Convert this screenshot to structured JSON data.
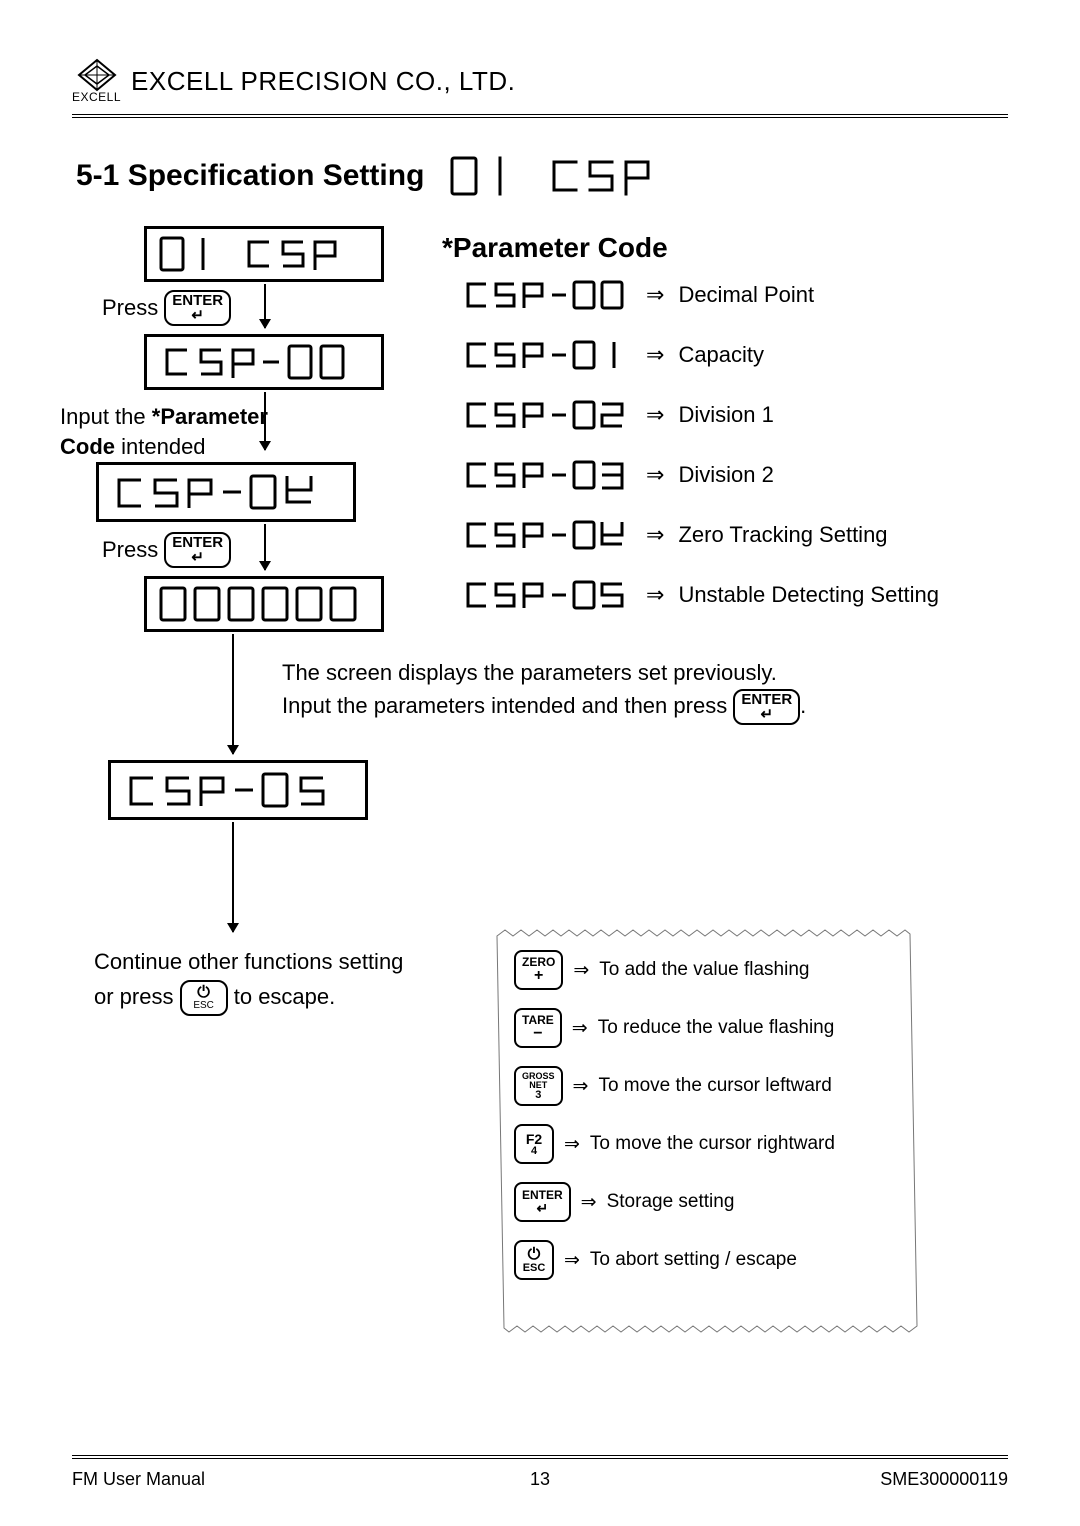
{
  "header": {
    "logo_text": "EXCELL",
    "company": "EXCELL PRECISION CO., LTD."
  },
  "section": {
    "number_and_title": "5-1 Specification Setting",
    "title_segment": "01  CSP"
  },
  "flow": {
    "lcd1": "01  CSP",
    "press1": "Press",
    "key_enter": "ENTER",
    "lcd2": "CSP-00",
    "input_label_line1": "Input the",
    "input_label_bold": "*Parameter",
    "input_label_line2": "Code",
    "input_label_rest": "intended",
    "lcd3": "CSP-04",
    "press2": "Press",
    "lcd4": "000000",
    "paragraph_line1": "The screen displays the parameters set previously.",
    "paragraph_line2_a": "Input the parameters intended and then press",
    "paragraph_line2_b": ".",
    "lcd5": "CSP-05",
    "continue_line1": "Continue other functions setting",
    "continue_line2a": "or press",
    "continue_line2b": "to escape.",
    "key_esc_top": "⏻",
    "key_esc_sub": "ESC"
  },
  "pcode": {
    "title": "*Parameter Code",
    "rows": [
      {
        "seg": "CSP-00",
        "desc": "Decimal Point"
      },
      {
        "seg": "CSP-01",
        "desc": "Capacity"
      },
      {
        "seg": "CSP-02",
        "desc": "Division 1"
      },
      {
        "seg": "CSP-03",
        "desc": "Division 2"
      },
      {
        "seg": "CSP-04",
        "desc": "Zero Tracking Setting"
      },
      {
        "seg": "CSP-05",
        "desc": "Unstable Detecting Setting"
      }
    ]
  },
  "legend": {
    "rows": [
      {
        "key_top": "ZERO",
        "key_sub": "+",
        "desc": "To add the value flashing"
      },
      {
        "key_top": "TARE",
        "key_sub": "−",
        "desc": "To reduce the value flashing"
      },
      {
        "key_top": "GROSS\nNET",
        "key_sub": "3",
        "desc": "To move the cursor leftward"
      },
      {
        "key_top": "F2",
        "key_sub": "4",
        "desc": "To move the cursor rightward"
      },
      {
        "key_top": "ENTER",
        "key_sub": "↵",
        "desc": "Storage setting"
      },
      {
        "key_top": "⏻",
        "key_sub": "ESC",
        "desc": "To abort setting / escape"
      }
    ]
  },
  "footer": {
    "left": "FM User Manual",
    "center": "13",
    "right": "SME300000119"
  }
}
